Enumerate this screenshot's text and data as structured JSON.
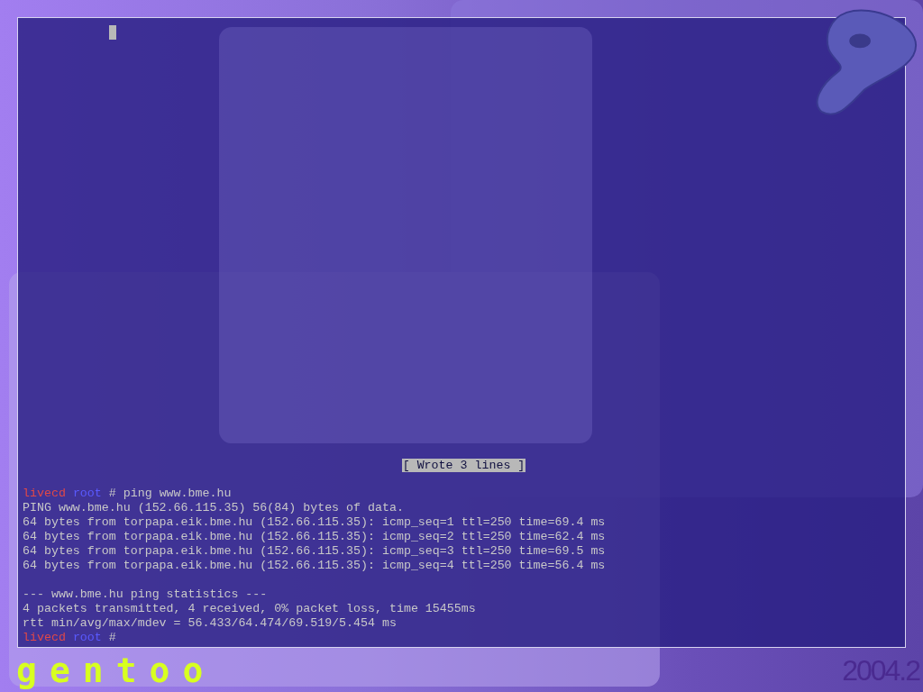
{
  "terminal": {
    "status_message": "[ Wrote 3 lines ]",
    "lines": [
      {
        "kind": "prompt",
        "host": "livecd",
        "user": "root",
        "symbol": "#",
        "command": "ping www.bme.hu"
      },
      {
        "kind": "output",
        "text": "PING www.bme.hu (152.66.115.35) 56(84) bytes of data."
      },
      {
        "kind": "output",
        "text": "64 bytes from torpapa.eik.bme.hu (152.66.115.35): icmp_seq=1 ttl=250 time=69.4 ms"
      },
      {
        "kind": "output",
        "text": "64 bytes from torpapa.eik.bme.hu (152.66.115.35): icmp_seq=2 ttl=250 time=62.4 ms"
      },
      {
        "kind": "output",
        "text": "64 bytes from torpapa.eik.bme.hu (152.66.115.35): icmp_seq=3 ttl=250 time=69.5 ms"
      },
      {
        "kind": "output",
        "text": "64 bytes from torpapa.eik.bme.hu (152.66.115.35): icmp_seq=4 ttl=250 time=56.4 ms"
      },
      {
        "kind": "blank"
      },
      {
        "kind": "output",
        "text": "--- www.bme.hu ping statistics ---"
      },
      {
        "kind": "output",
        "text": "4 packets transmitted, 4 received, 0% packet loss, time 15455ms"
      },
      {
        "kind": "output",
        "text": "rtt min/avg/max/mdev = 56.433/64.474/69.519/5.454 ms"
      },
      {
        "kind": "prompt",
        "host": "livecd",
        "user": "root",
        "symbol": "#"
      }
    ]
  },
  "wallpaper": {
    "logo_text": "gentoo",
    "version": "2004.2"
  }
}
